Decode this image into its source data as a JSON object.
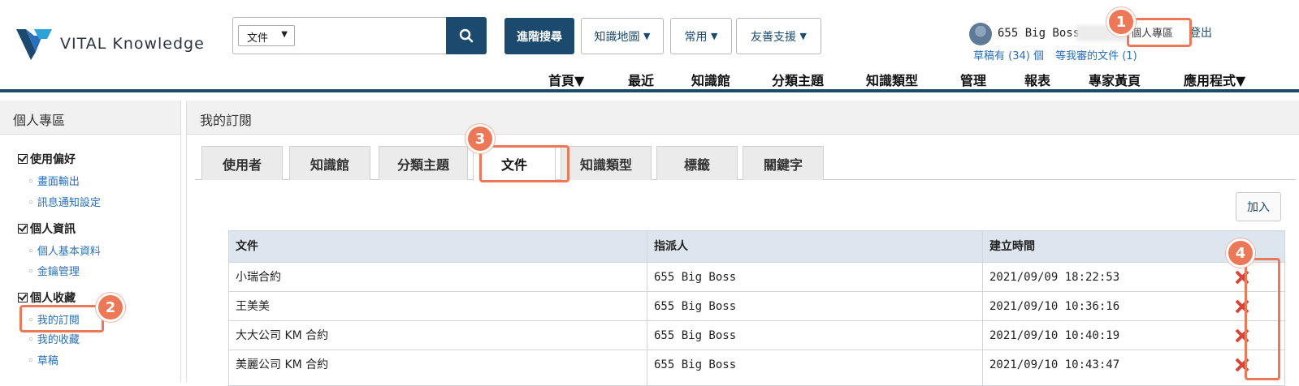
{
  "header": {
    "logo_text": "VITAL Knowledge",
    "search_scope": "文件",
    "advanced_search": "進階搜尋",
    "dropdowns": [
      "知識地圖",
      "常用",
      "友善支援"
    ],
    "user_name": "655 Big Boss",
    "personal_zone": "個人專區",
    "logout": "登出",
    "drafts_link": "草稿有 (34) 個",
    "pending_link": "等我審的文件 (1)"
  },
  "main_nav": [
    "首頁▼",
    "最近",
    "知識館",
    "分類主題",
    "知識類型",
    "管理",
    "報表",
    "專家黃頁",
    "應用程式▼"
  ],
  "sidebar": {
    "title": "個人專區",
    "sections": [
      {
        "label": "使用偏好",
        "items": [
          "畫面輸出",
          "訊息通知設定"
        ]
      },
      {
        "label": "個人資訊",
        "items": [
          "個人基本資料",
          "金鑰管理"
        ]
      },
      {
        "label": "個人收藏",
        "items": [
          "我的訂閱",
          "我的收藏",
          "草稿"
        ]
      }
    ]
  },
  "panel": {
    "title": "我的訂閱",
    "tabs": [
      "使用者",
      "知識館",
      "分類主題",
      "文件",
      "知識類型",
      "標籤",
      "關鍵字"
    ],
    "active_tab": "文件",
    "add_button": "加入",
    "columns": [
      "文件",
      "指派人",
      "建立時間"
    ],
    "rows": [
      {
        "doc": "小瑞合約",
        "assignee": "655 Big Boss",
        "created": "2021/09/09 18:22:53"
      },
      {
        "doc": "王美美",
        "assignee": "655 Big Boss",
        "created": "2021/09/10 10:36:16"
      },
      {
        "doc": "大大公司 KM 合約",
        "assignee": "655 Big Boss",
        "created": "2021/09/10 10:40:19"
      },
      {
        "doc": "美麗公司 KM 合約",
        "assignee": "655 Big Boss",
        "created": "2021/09/10 10:43:47"
      }
    ]
  },
  "callouts": [
    "1",
    "2",
    "3",
    "4"
  ],
  "colors": {
    "brand": "#1b4a6e",
    "link": "#2a6fbd",
    "callout": "#ec7857",
    "delete": "#d9453a"
  }
}
